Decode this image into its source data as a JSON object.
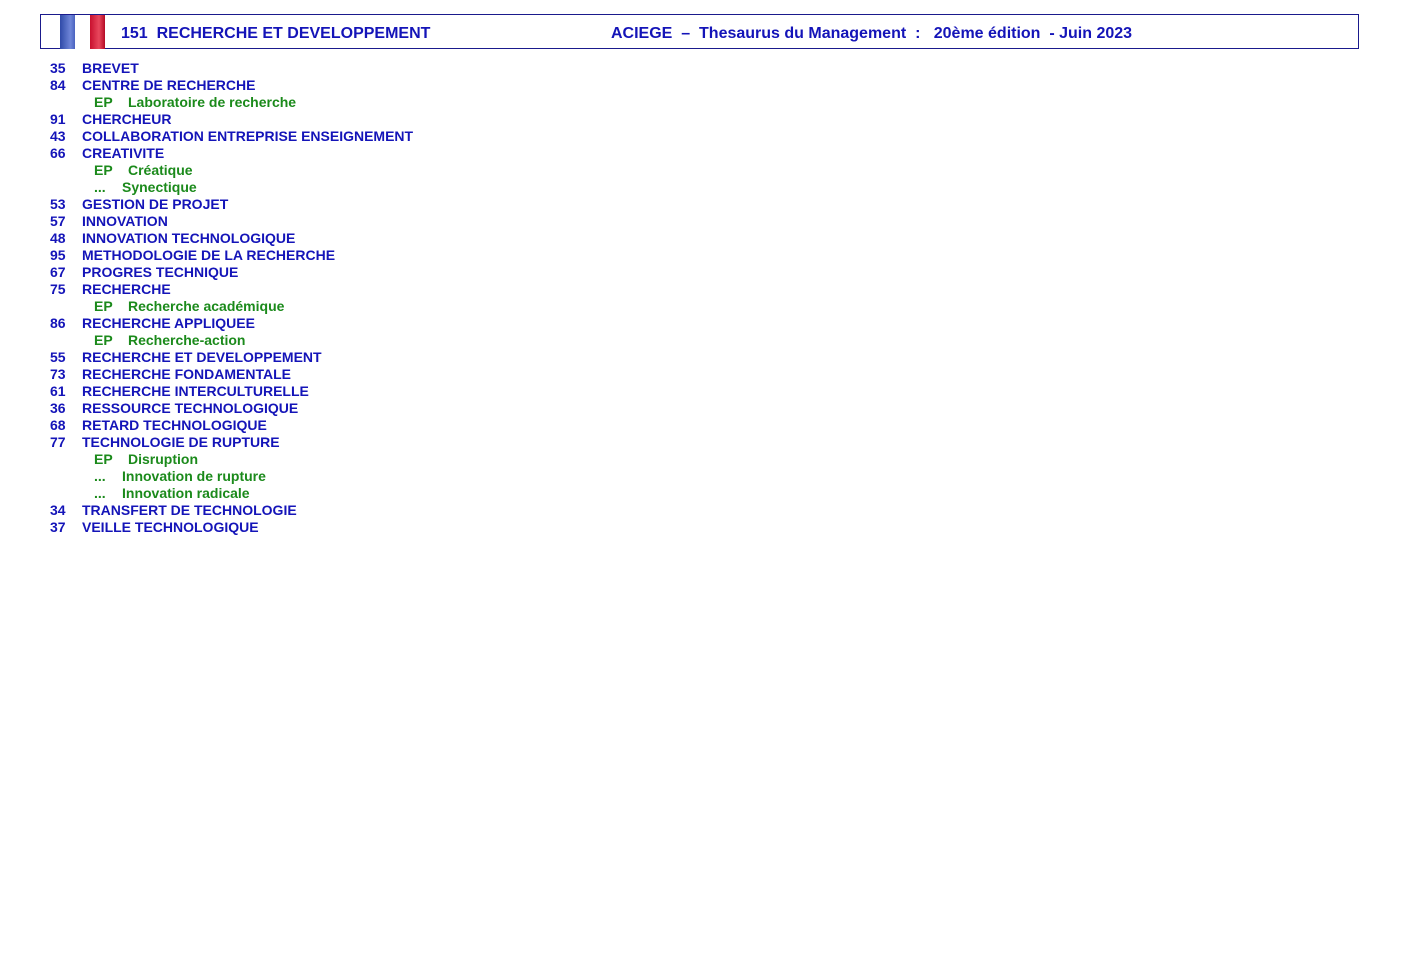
{
  "header": {
    "code": "151",
    "title": "RECHERCHE ET DEVELOPPEMENT",
    "org": "ACIEGE",
    "dash": "–",
    "publication": "Thesaurus du Management",
    "colon": ":",
    "edition": "20ème édition",
    "date": "- Juin 2023",
    "flag_colors": [
      "#3a55b4",
      "#ffffff",
      "#d4183a"
    ]
  },
  "colors": {
    "term": "#1414b8",
    "synonym": "#1b8a1b",
    "border": "#1a1a8c"
  },
  "entries": [
    {
      "kind": "term",
      "num": "35",
      "text": "BREVET"
    },
    {
      "kind": "term",
      "num": "84",
      "text": "CENTRE DE RECHERCHE"
    },
    {
      "kind": "ep",
      "tag": "EP",
      "text": "Laboratoire de recherche"
    },
    {
      "kind": "term",
      "num": "91",
      "text": "CHERCHEUR"
    },
    {
      "kind": "term",
      "num": "43",
      "text": "COLLABORATION ENTREPRISE ENSEIGNEMENT"
    },
    {
      "kind": "term",
      "num": "66",
      "text": "CREATIVITE"
    },
    {
      "kind": "ep",
      "tag": "EP",
      "text": "Créatique"
    },
    {
      "kind": "dots",
      "tag": "...",
      "text": "Synectique"
    },
    {
      "kind": "term",
      "num": "53",
      "text": "GESTION DE PROJET"
    },
    {
      "kind": "term",
      "num": "57",
      "text": "INNOVATION"
    },
    {
      "kind": "term",
      "num": "48",
      "text": "INNOVATION TECHNOLOGIQUE"
    },
    {
      "kind": "term",
      "num": "95",
      "text": "METHODOLOGIE DE LA RECHERCHE"
    },
    {
      "kind": "term",
      "num": "67",
      "text": "PROGRES TECHNIQUE"
    },
    {
      "kind": "term",
      "num": "75",
      "text": "RECHERCHE"
    },
    {
      "kind": "ep",
      "tag": "EP",
      "text": "Recherche académique"
    },
    {
      "kind": "term",
      "num": "86",
      "text": "RECHERCHE APPLIQUEE"
    },
    {
      "kind": "ep",
      "tag": "EP",
      "text": "Recherche-action"
    },
    {
      "kind": "term",
      "num": "55",
      "text": "RECHERCHE ET DEVELOPPEMENT"
    },
    {
      "kind": "term",
      "num": "73",
      "text": "RECHERCHE FONDAMENTALE"
    },
    {
      "kind": "term",
      "num": "61",
      "text": "RECHERCHE INTERCULTURELLE"
    },
    {
      "kind": "term",
      "num": "36",
      "text": "RESSOURCE TECHNOLOGIQUE"
    },
    {
      "kind": "term",
      "num": "68",
      "text": "RETARD TECHNOLOGIQUE"
    },
    {
      "kind": "term",
      "num": "77",
      "text": "TECHNOLOGIE DE RUPTURE"
    },
    {
      "kind": "ep",
      "tag": "EP",
      "text": "Disruption"
    },
    {
      "kind": "dots",
      "tag": "...",
      "text": "Innovation de rupture"
    },
    {
      "kind": "dots",
      "tag": "...",
      "text": "Innovation radicale"
    },
    {
      "kind": "term",
      "num": "34",
      "text": "TRANSFERT DE TECHNOLOGIE"
    },
    {
      "kind": "term",
      "num": "37",
      "text": "VEILLE TECHNOLOGIQUE"
    }
  ]
}
